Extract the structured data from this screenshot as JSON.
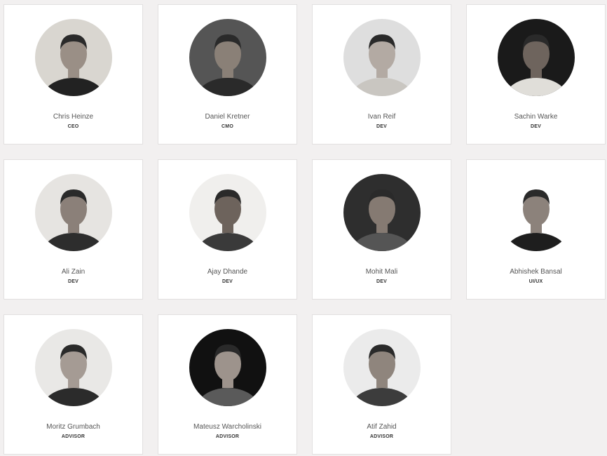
{
  "team": {
    "members": [
      {
        "name": "Chris Heinze",
        "role": "CEO",
        "avatar_bg": "#d9d6d0",
        "shirt": "#222222",
        "face_tone": "#9a8f86"
      },
      {
        "name": "Daniel Kretner",
        "role": "CMO",
        "avatar_bg": "#555555",
        "shirt": "#2a2a2a",
        "face_tone": "#8a8077"
      },
      {
        "name": "Ivan Reif",
        "role": "DEV",
        "avatar_bg": "#dedede",
        "shirt": "#c9c6c1",
        "face_tone": "#b3aaa3"
      },
      {
        "name": "Sachin Warke",
        "role": "DEV",
        "avatar_bg": "#1a1a1a",
        "shirt": "#e0ded9",
        "face_tone": "#6e645d"
      },
      {
        "name": "Ali Zain",
        "role": "DEV",
        "avatar_bg": "#e6e4e1",
        "shirt": "#2d2d2d",
        "face_tone": "#8b8079"
      },
      {
        "name": "Ajay Dhande",
        "role": "DEV",
        "avatar_bg": "#f0efed",
        "shirt": "#3a3a3a",
        "face_tone": "#6d635c"
      },
      {
        "name": "Mohit Mali",
        "role": "DEV",
        "avatar_bg": "#2e2e2e",
        "shirt": "#555555",
        "face_tone": "#857a72"
      },
      {
        "name": "Abhishek Bansal",
        "role": "UI/UX",
        "avatar_bg": "#ffffff",
        "shirt": "#1e1e1e",
        "face_tone": "#8c827b"
      },
      {
        "name": "Moritz Grumbach",
        "role": "ADVISOR",
        "avatar_bg": "#e9e8e6",
        "shirt": "#2b2b2b",
        "face_tone": "#a59b94"
      },
      {
        "name": "Mateusz Warcholinski",
        "role": "ADVISOR",
        "avatar_bg": "#111111",
        "shirt": "#5a5a5a",
        "face_tone": "#9d938c"
      },
      {
        "name": "Atif Zahid",
        "role": "ADVISOR",
        "avatar_bg": "#ebebeb",
        "shirt": "#3c3c3c",
        "face_tone": "#8f857d"
      }
    ]
  }
}
